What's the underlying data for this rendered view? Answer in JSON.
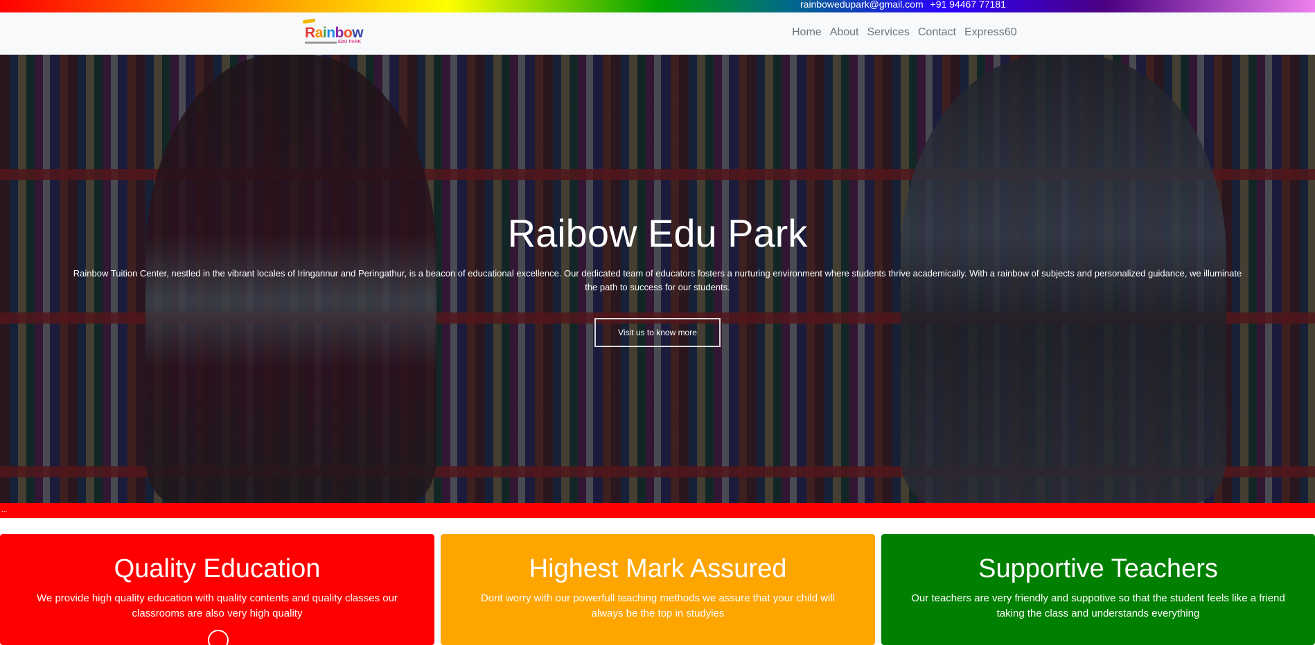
{
  "topbar": {
    "email": "rainbowedupark@gmail.com",
    "phone": "+91 94467 77181"
  },
  "logo": {
    "word": "Rainbow",
    "sub": "EDU PARK"
  },
  "nav": {
    "items": [
      {
        "label": "Home"
      },
      {
        "label": "About"
      },
      {
        "label": "Services"
      },
      {
        "label": "Contact"
      },
      {
        "label": "Express60"
      }
    ]
  },
  "hero": {
    "title": "Raibow Edu Park",
    "text": "Rainbow Tuition Center, nestled in the vibrant locales of Iringannur and Peringathur, is a beacon of educational excellence. Our dedicated team of educators fosters a nurturing environment where students thrive academically. With a rainbow of subjects and personalized guidance, we illuminate the path to success for our students.",
    "button": "Visit us to know more"
  },
  "strip": {
    "text": "..."
  },
  "cards": [
    {
      "title": "Quality Education",
      "text": "We provide high quality education with quality contents and quality classes our classrooms are also very high quality",
      "color": "#ff0000"
    },
    {
      "title": "Highest Mark Assured",
      "text": "Dont worry with our powerfull teaching methods we assure that your child will always be the top in studyies",
      "color": "#ffa500"
    },
    {
      "title": "Supportive Teachers",
      "text": "Our teachers are very friendly and suppotive so that the student feels like a friend taking the class and understands everything",
      "color": "#008000"
    }
  ],
  "colors": {
    "navbar_bg": "#f8f9fa",
    "nav_text": "#6c757d",
    "strip": "#ff0000"
  }
}
